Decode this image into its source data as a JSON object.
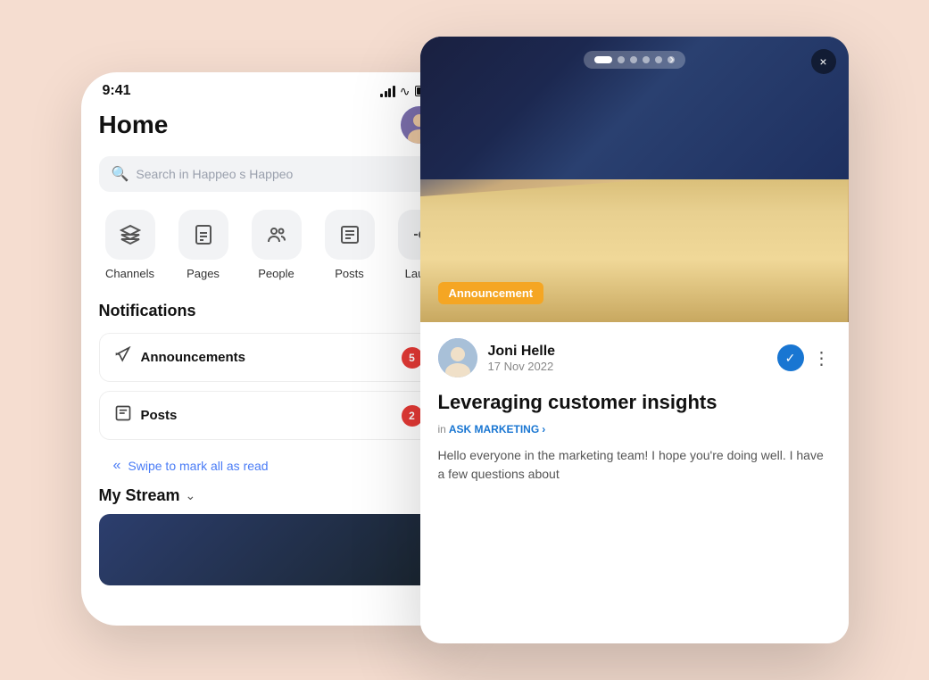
{
  "background": "#f5ddd0",
  "phone_left": {
    "status_bar": {
      "time": "9:41"
    },
    "home_title": "Home",
    "search_placeholder": "Search in Happeo s Happeo",
    "quick_links": [
      {
        "id": "channels",
        "icon": "◈",
        "label": "Channels"
      },
      {
        "id": "pages",
        "icon": "📖",
        "label": "Pages"
      },
      {
        "id": "people",
        "icon": "👥",
        "label": "People"
      },
      {
        "id": "posts",
        "icon": "📄",
        "label": "Posts"
      },
      {
        "id": "launch",
        "icon": "🚀",
        "label": "Laun..."
      }
    ],
    "notifications_title": "Notifications",
    "notifications": [
      {
        "id": "announcements",
        "label": "Announcements",
        "badge": 5
      },
      {
        "id": "posts",
        "label": "Posts",
        "badge": 2
      }
    ],
    "swipe_hint": "Swipe to mark all as read",
    "my_stream_label": "My Stream"
  },
  "card_right": {
    "announcement_badge": "Announcement",
    "carousel_dots": 6,
    "close_label": "×",
    "author_name": "Joni Helle",
    "author_date": "17 Nov 2022",
    "post_title": "Leveraging customer insights",
    "channel_prefix": "in",
    "channel_name": "ASK MARKETING",
    "excerpt": "Hello everyone in the marketing team! I hope you're doing well. I have a few questions about"
  }
}
